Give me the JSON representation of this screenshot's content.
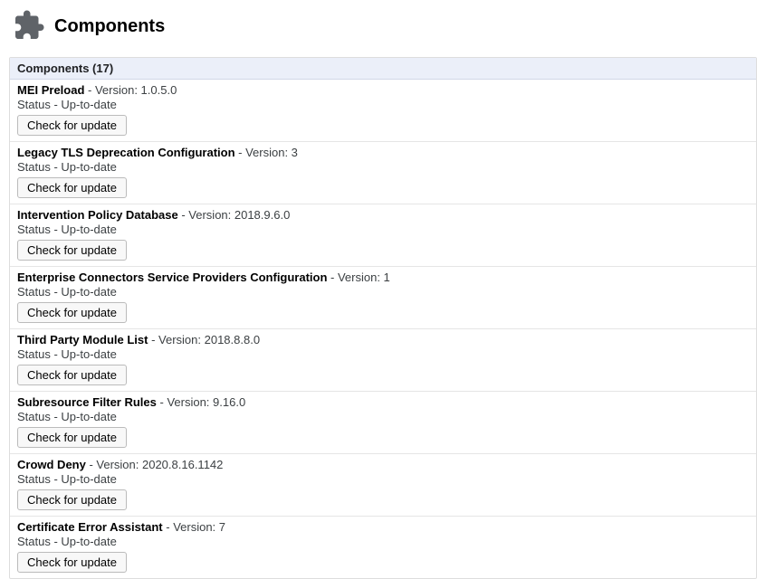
{
  "page": {
    "title": "Components",
    "section_header": "Components (17)",
    "version_prefix": " - Version: ",
    "status_prefix": "Status - ",
    "check_label": "Check for update"
  },
  "components": [
    {
      "name": "MEI Preload",
      "version": "1.0.5.0",
      "status": "Up-to-date"
    },
    {
      "name": "Legacy TLS Deprecation Configuration",
      "version": "3",
      "status": "Up-to-date"
    },
    {
      "name": "Intervention Policy Database",
      "version": "2018.9.6.0",
      "status": "Up-to-date"
    },
    {
      "name": "Enterprise Connectors Service Providers Configuration",
      "version": "1",
      "status": "Up-to-date"
    },
    {
      "name": "Third Party Module List",
      "version": "2018.8.8.0",
      "status": "Up-to-date"
    },
    {
      "name": "Subresource Filter Rules",
      "version": "9.16.0",
      "status": "Up-to-date"
    },
    {
      "name": "Crowd Deny",
      "version": "2020.8.16.1142",
      "status": "Up-to-date"
    },
    {
      "name": "Certificate Error Assistant",
      "version": "7",
      "status": "Up-to-date"
    }
  ]
}
